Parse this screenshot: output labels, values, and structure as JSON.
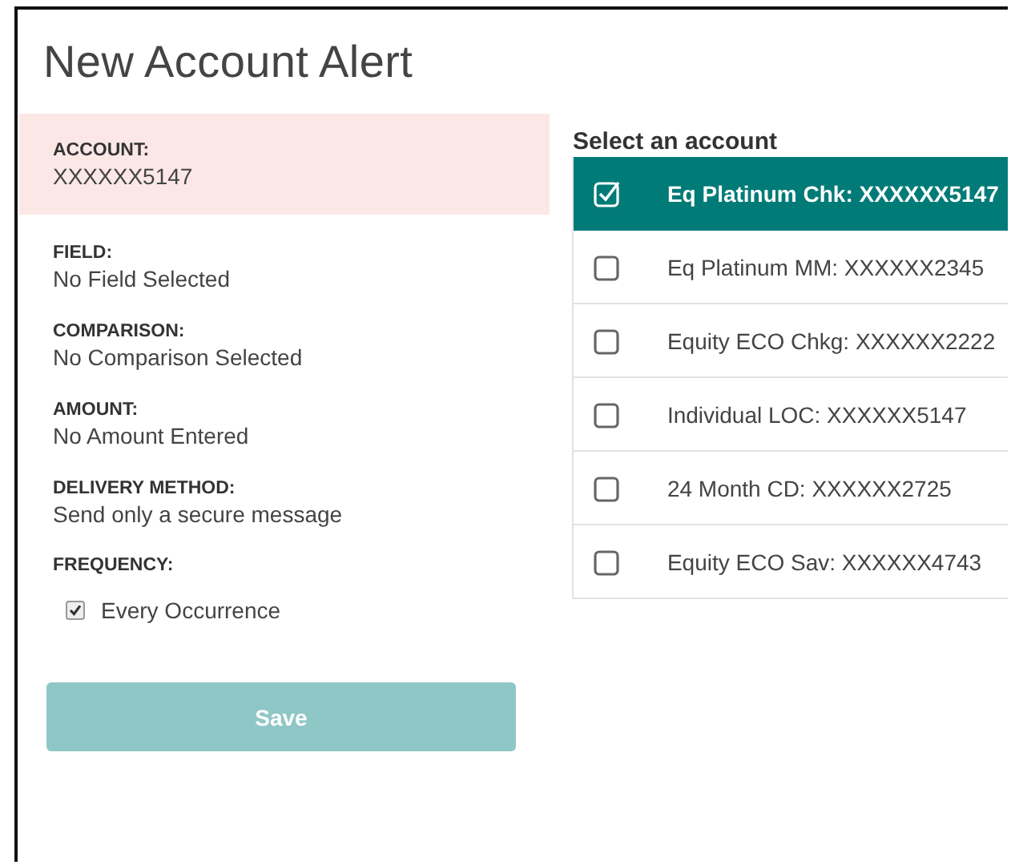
{
  "title": "New Account Alert",
  "summary": [
    {
      "label": "ACCOUNT:",
      "value": "XXXXXX5147",
      "highlighted": true
    },
    {
      "label": "FIELD:",
      "value": "No Field Selected",
      "highlighted": false
    },
    {
      "label": "COMPARISON:",
      "value": "No Comparison Selected",
      "highlighted": false
    },
    {
      "label": "AMOUNT:",
      "value": "No Amount Entered",
      "highlighted": false
    },
    {
      "label": "DELIVERY METHOD:",
      "value": "Send only a secure message",
      "highlighted": false
    }
  ],
  "frequency": {
    "label": "FREQUENCY:",
    "option": "Every Occurrence",
    "checked": true
  },
  "save_button": {
    "label": "Save",
    "disabled": true
  },
  "account_list": {
    "heading": "Select an account",
    "accounts": [
      {
        "name": "Eq Platinum Chk: XXXXXX5147",
        "selected": true
      },
      {
        "name": "Eq Platinum MM: XXXXXX2345",
        "selected": false
      },
      {
        "name": "Equity ECO Chkg: XXXXXX2222",
        "selected": false
      },
      {
        "name": "Individual LOC: XXXXXX5147",
        "selected": false
      },
      {
        "name": "24 Month CD: XXXXXX2725",
        "selected": false
      },
      {
        "name": "Equity ECO Sav: XXXXXX4743",
        "selected": false
      }
    ]
  }
}
